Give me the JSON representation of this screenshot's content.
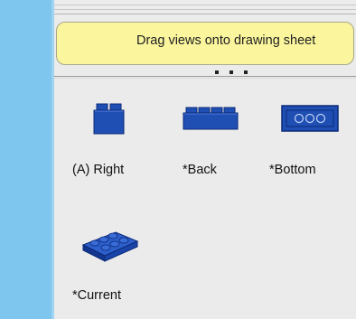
{
  "banner": {
    "text": "Drag views onto drawing sheet"
  },
  "views": [
    {
      "label": "(A) Right",
      "icon": "brick-right-view-icon"
    },
    {
      "label": "*Back",
      "icon": "brick-back-view-icon"
    },
    {
      "label": "*Bottom",
      "icon": "brick-bottom-view-icon"
    },
    {
      "label": "*Current",
      "icon": "brick-isometric-view-icon"
    }
  ],
  "colors": {
    "brick_blue": "#1f4fb3",
    "brick_dark": "#0b2a78",
    "banner_yellow": "#fbf59d",
    "side_strip": "#7fc6ee"
  }
}
